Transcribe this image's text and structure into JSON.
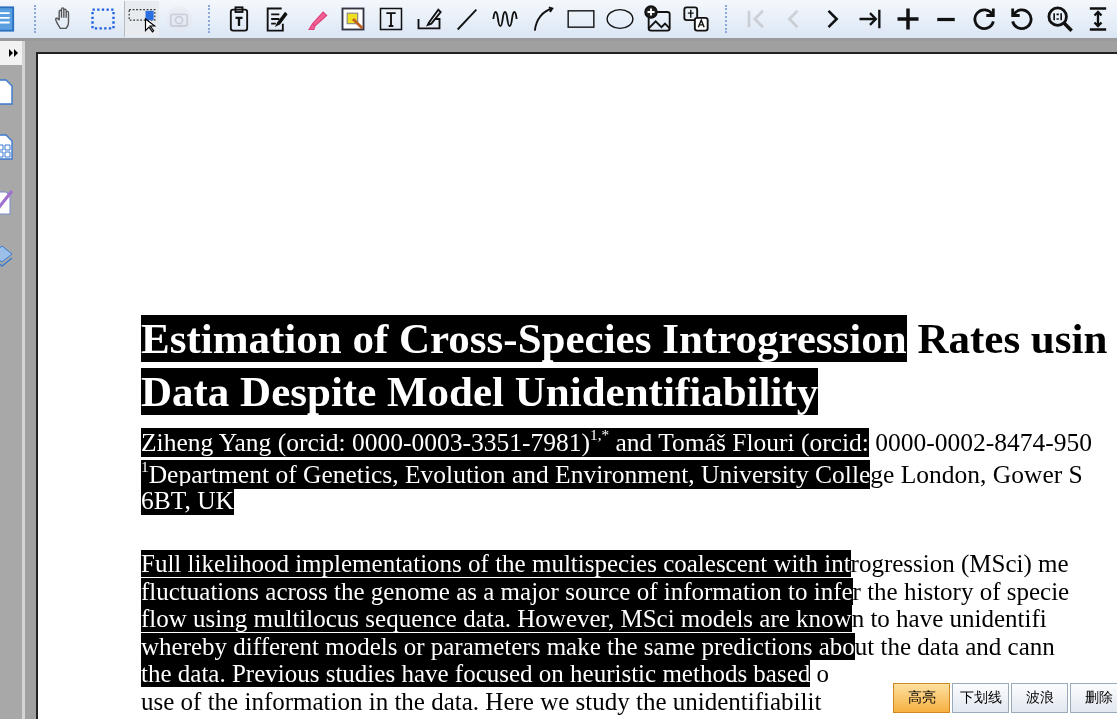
{
  "toolbar": [
    {
      "kind": "list-doc",
      "selected": false,
      "disabled": false
    },
    {
      "kind": "separator"
    },
    {
      "kind": "hand",
      "selected": false,
      "disabled": false
    },
    {
      "kind": "marquee",
      "selected": false,
      "disabled": false
    },
    {
      "kind": "select-text",
      "selected": true,
      "disabled": false
    },
    {
      "kind": "camera",
      "selected": false,
      "disabled": true
    },
    {
      "kind": "separator"
    },
    {
      "kind": "paste-text",
      "selected": false,
      "disabled": false
    },
    {
      "kind": "edit-doc",
      "selected": false,
      "disabled": false
    },
    {
      "kind": "highlighter",
      "selected": false,
      "disabled": false
    },
    {
      "kind": "note",
      "selected": false,
      "disabled": false
    },
    {
      "kind": "textbox",
      "selected": false,
      "disabled": false
    },
    {
      "kind": "sign",
      "selected": false,
      "disabled": false
    },
    {
      "kind": "line",
      "selected": false,
      "disabled": false
    },
    {
      "kind": "wave",
      "selected": false,
      "disabled": false
    },
    {
      "kind": "arc",
      "selected": false,
      "disabled": false
    },
    {
      "kind": "rect",
      "selected": false,
      "disabled": false
    },
    {
      "kind": "ellipse",
      "selected": false,
      "disabled": false
    },
    {
      "kind": "add-image",
      "selected": false,
      "disabled": false
    },
    {
      "kind": "translate",
      "selected": false,
      "disabled": false
    },
    {
      "kind": "separator"
    },
    {
      "kind": "first",
      "selected": false,
      "disabled": true
    },
    {
      "kind": "prev",
      "selected": false,
      "disabled": true
    },
    {
      "kind": "next",
      "selected": false,
      "disabled": false
    },
    {
      "kind": "last",
      "selected": false,
      "disabled": false
    },
    {
      "kind": "zoom-in",
      "selected": false,
      "disabled": false
    },
    {
      "kind": "zoom-out",
      "selected": false,
      "disabled": false
    },
    {
      "kind": "rotate-cw",
      "selected": false,
      "disabled": false
    },
    {
      "kind": "rotate-ccw",
      "selected": false,
      "disabled": false
    },
    {
      "kind": "zoom-fit",
      "selected": false,
      "disabled": false
    },
    {
      "kind": "fit-height",
      "selected": false,
      "disabled": false
    }
  ],
  "sidebar": {
    "items": [
      {
        "kind": "page"
      },
      {
        "kind": "thumbnails"
      },
      {
        "kind": "annotations"
      },
      {
        "kind": "layers"
      }
    ]
  },
  "document": {
    "title": [
      [
        {
          "text": "Estimation of Cross-Species Introgression",
          "selected": true
        },
        {
          "text": " Rates usin",
          "selected": false
        }
      ],
      [
        {
          "text": "Data Despite Model Unidentifiability",
          "selected": true
        }
      ]
    ],
    "authors": [
      [
        {
          "text": "Ziheng Yang (orcid: 0000-0003-3351-7981)$^{1,*}$ and Tomáš Flouri (orcid:",
          "selected": true
        },
        {
          "text": " 0000-0002-8474-950",
          "selected": false
        }
      ]
    ],
    "affiliation": [
      [
        {
          "text": "$^{1}$Department of Genetics, Evolution and Environment, University Colle",
          "selected": true
        },
        {
          "text": "ge London, Gower S",
          "selected": false
        }
      ],
      [
        {
          "text": "6BT, UK",
          "selected": true
        }
      ]
    ],
    "abstract": [
      [
        {
          "text": "Full likelihood implementations of the multispecies coalescent with int",
          "selected": true
        },
        {
          "text": "rogression (MSci) me",
          "selected": false
        }
      ],
      [
        {
          "text": "fluctuations across the genome as a major source of information to infe",
          "selected": true
        },
        {
          "text": "r the history of specie",
          "selected": false
        }
      ],
      [
        {
          "text": "flow using multilocus sequence data. However, MSci models are know",
          "selected": true
        },
        {
          "text": "n to have unidentifi",
          "selected": false
        }
      ],
      [
        {
          "text": "whereby different models or parameters make the same predictions abo",
          "selected": true
        },
        {
          "text": "ut the data and cann",
          "selected": false
        }
      ],
      [
        {
          "text": "the data. Previous studies have focused on heuristic methods based",
          "selected": true
        },
        {
          "text": " o",
          "selected": false
        }
      ],
      [
        {
          "text": "use of the information in the data. Here we study the unidentifiabilit",
          "selected": false
        }
      ]
    ]
  },
  "popup": {
    "buttons": [
      {
        "label": "高亮",
        "selected": true
      },
      {
        "label": "下划线",
        "selected": false
      },
      {
        "label": "波浪",
        "selected": false
      },
      {
        "label": "删除",
        "selected": false
      }
    ]
  }
}
